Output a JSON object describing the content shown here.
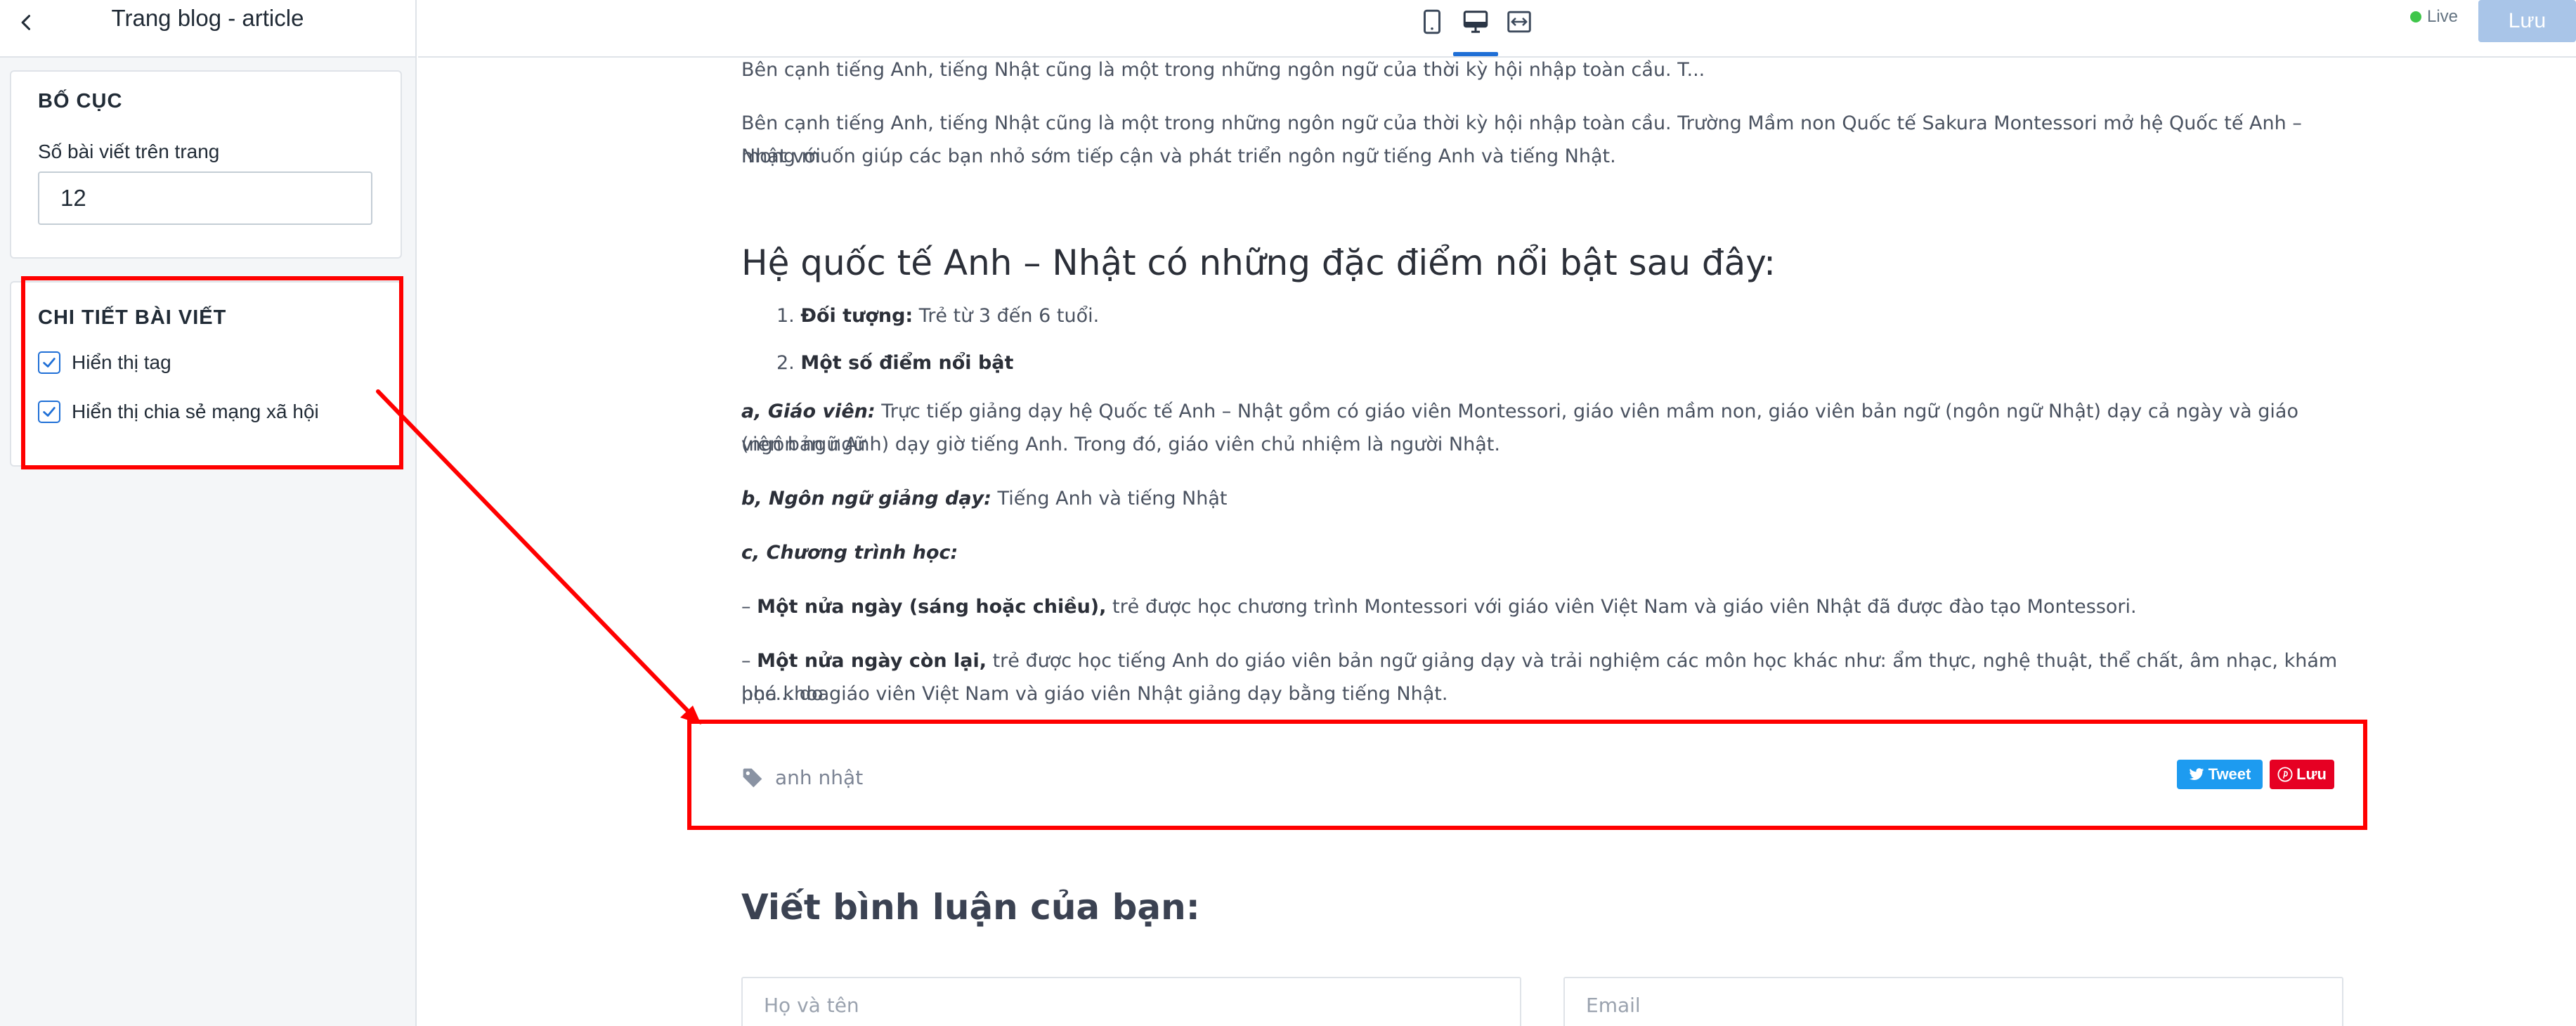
{
  "sidebar": {
    "title": "Trang blog - article",
    "layout_card": {
      "title": "BỐ CỤC",
      "posts_per_page_label": "Số bài viết trên trang",
      "posts_per_page_value": "12"
    },
    "detail_card": {
      "title": "CHI TIẾT BÀI VIẾT",
      "show_tag_label": "Hiển thị tag",
      "show_tag_checked": true,
      "show_share_label": "Hiển thị chia sẻ mạng xã hội",
      "show_share_checked": true
    }
  },
  "topbar": {
    "devices": [
      "mobile-icon",
      "desktop-icon",
      "fullwidth-icon"
    ],
    "active_device": "desktop-icon",
    "live_label": "Live",
    "save_label": "Lưu",
    "colors": {
      "accent": "#1f6fd6",
      "save_disabled": "#a9c5e8",
      "live_dot": "#3fc64a"
    }
  },
  "article": {
    "excerpt": "Bên cạnh tiếng Anh, tiếng Nhật cũng là một trong những ngôn ngữ của thời kỳ hội nhập toàn cầu. T...",
    "intro_line1": "Bên cạnh tiếng Anh, tiếng Nhật cũng là một trong những ngôn ngữ của thời kỳ hội nhập toàn cầu. Trường Mầm non Quốc tế Sakura Montessori mở hệ Quốc tế Anh – Nhật với",
    "intro_line2": "mong muốn giúp các bạn nhỏ sớm tiếp cận và phát triển ngôn ngữ tiếng Anh và tiếng Nhật.",
    "heading": "Hệ quốc tế Anh – Nhật có những đặc điểm nổi bật sau đây:",
    "list": {
      "item1_num": "1.",
      "item1_bold": "Đối tượng:",
      "item1_text": " Trẻ từ 3 đến 6 tuổi.",
      "item2_num": "2.",
      "item2_bold": "Một số điểm nổi bật"
    },
    "teachers_label": "a, Giáo viên:",
    "teachers_line1": " Trực tiếp giảng dạy hệ Quốc tế Anh – Nhật gồm có giáo viên Montessori, giáo viên mầm non, giáo viên bản ngữ (ngôn ngữ Nhật) dạy cả ngày và giáo viên bản ngữ",
    "teachers_line2": "(ngôn ngữ Anh) dạy giờ tiếng Anh. Trong đó, giáo viên chủ nhiệm là người Nhật.",
    "language_label": "b, Ngôn ngữ giảng dạy:",
    "language_text": " Tiếng Anh và tiếng Nhật",
    "program_label": "c, Chương trình học:",
    "half1_dash": "– ",
    "half1_bold": "Một nửa ngày (sáng hoặc chiều),",
    "half1_text": " trẻ được học chương trình Montessori với giáo viên Việt Nam và giáo viên Nhật đã được đào tạo Montessori.",
    "half2_dash": "– ",
    "half2_bold": "Một nửa ngày còn lại,",
    "half2_text_line1": " trẻ được học tiếng Anh do giáo viên bản ngữ giảng dạy và trải nghiệm các môn học khác như: ẩm thực, nghệ thuật, thể chất, âm nhạc, khám phá khoa",
    "half2_text_line2": "học... do giáo viên Việt Nam và giáo viên Nhật giảng dạy bằng tiếng Nhật.",
    "tag": "anh nhật",
    "tweet_label": "Tweet",
    "pin_label": "Lưu",
    "comment_heading": "Viết bình luận của bạn:",
    "name_placeholder": "Họ và tên",
    "email_placeholder": "Email"
  },
  "annotation_color": "#ff0000"
}
